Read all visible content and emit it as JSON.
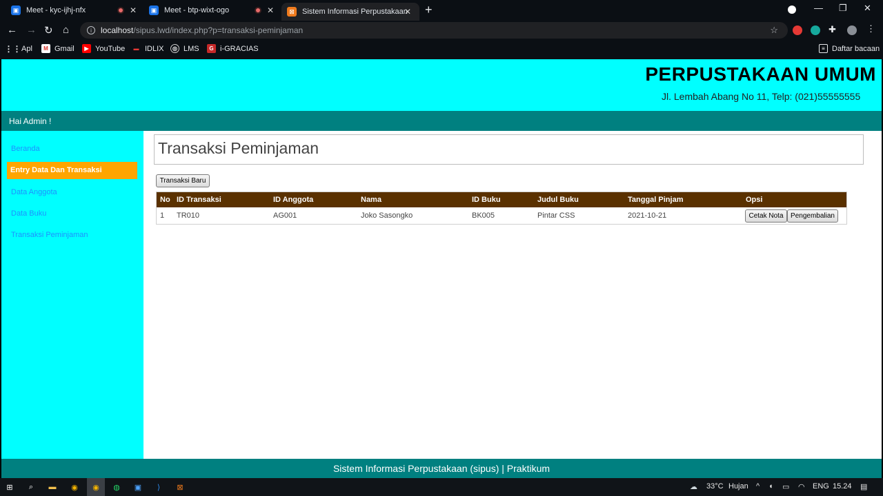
{
  "browser": {
    "tabs": [
      {
        "title": "Meet - kyc-ijhj-nfx"
      },
      {
        "title": "Meet - btp-wixt-ogo"
      },
      {
        "title": "Sistem Informasi Perpustakaan"
      }
    ],
    "url_host": "localhost",
    "url_path": "/sipus.lwd/index.php?p=transaksi-peminjaman",
    "bookmarks": [
      {
        "label": "Apl",
        "icon": "apps-grid-icon"
      },
      {
        "label": "Gmail",
        "icon": "gmail-icon"
      },
      {
        "label": "YouTube",
        "icon": "youtube-icon"
      },
      {
        "label": "IDLIX",
        "icon": "idlix-icon"
      },
      {
        "label": "LMS",
        "icon": "lms-icon"
      },
      {
        "label": "i-GRACIAS",
        "icon": "igracias-icon"
      }
    ],
    "reading_list": "Daftar bacaan"
  },
  "header": {
    "title": "PERPUSTAKAAN UMUM",
    "address": "Jl. Lembah Abang No 11, Telp: (021)55555555"
  },
  "greeting": "Hai Admin !",
  "sidebar": {
    "items": [
      {
        "label": "Beranda"
      },
      {
        "label": "Entry Data Dan Transaksi"
      },
      {
        "label": "Data Anggota"
      },
      {
        "label": "Data Buku"
      },
      {
        "label": "Transaksi Peminjaman"
      }
    ]
  },
  "main": {
    "title": "Transaksi Peminjaman",
    "new_button": "Transaksi Baru",
    "columns": [
      "No",
      "ID Transaksi",
      "ID Anggota",
      "Nama",
      "ID Buku",
      "Judul Buku",
      "Tanggal Pinjam",
      "Opsi"
    ],
    "rows": [
      {
        "no": "1",
        "id_transaksi": "TR010",
        "id_anggota": "AG001",
        "nama": "Joko Sasongko",
        "id_buku": "BK005",
        "judul_buku": "Pintar CSS",
        "tanggal_pinjam": "2021-10-21",
        "print_label": "Cetak Nota",
        "return_label": "Pengembalian"
      }
    ]
  },
  "footer": "Sistem Informasi Perpustakaan (sipus) | Praktikum",
  "taskbar": {
    "temperature": "33°C",
    "weather": "Hujan",
    "language": "ENG",
    "time": "15.24"
  },
  "colors": {
    "header_bg": "#00ffff",
    "bar_bg": "#008080",
    "active_menu": "#ffa500",
    "table_header": "#5a3100",
    "link": "#1e90ff"
  }
}
